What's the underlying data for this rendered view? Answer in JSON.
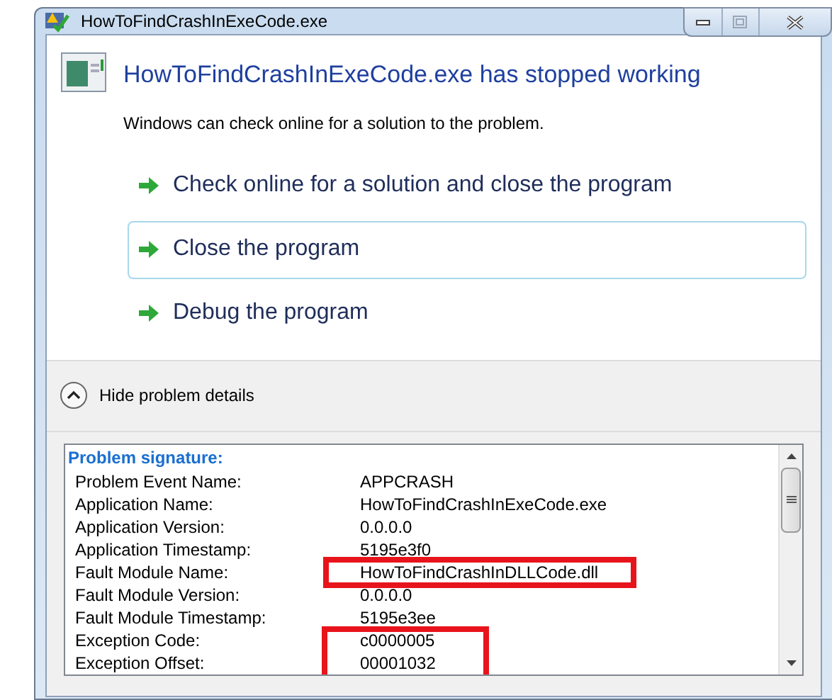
{
  "window": {
    "title": "HowToFindCrashInExeCode.exe"
  },
  "heading": "HowToFindCrashInExeCode.exe has stopped working",
  "message": "Windows can check online for a solution to the problem.",
  "options": [
    {
      "label": "Check online for a solution and close the program",
      "selected": false
    },
    {
      "label": "Close the program",
      "selected": true
    },
    {
      "label": "Debug the program",
      "selected": false
    }
  ],
  "details_toggle": {
    "label": "Hide problem details",
    "expanded": true
  },
  "details": {
    "title": "Problem signature:",
    "rows": [
      {
        "label": "Problem Event Name:",
        "value": "APPCRASH",
        "highlighted": false
      },
      {
        "label": "Application Name:",
        "value": "HowToFindCrashInExeCode.exe",
        "highlighted": false
      },
      {
        "label": "Application Version:",
        "value": "0.0.0.0",
        "highlighted": false
      },
      {
        "label": "Application Timestamp:",
        "value": "5195e3f0",
        "highlighted": false
      },
      {
        "label": "Fault Module Name:",
        "value": "HowToFindCrashInDLLCode.dll",
        "highlighted": true
      },
      {
        "label": "Fault Module Version:",
        "value": "0.0.0.0",
        "highlighted": false
      },
      {
        "label": "Fault Module Timestamp:",
        "value": "5195e3ee",
        "highlighted": false
      },
      {
        "label": "Exception Code:",
        "value": "c0000005",
        "highlighted": true
      },
      {
        "label": "Exception Offset:",
        "value": "00001032",
        "highlighted": true
      }
    ]
  }
}
